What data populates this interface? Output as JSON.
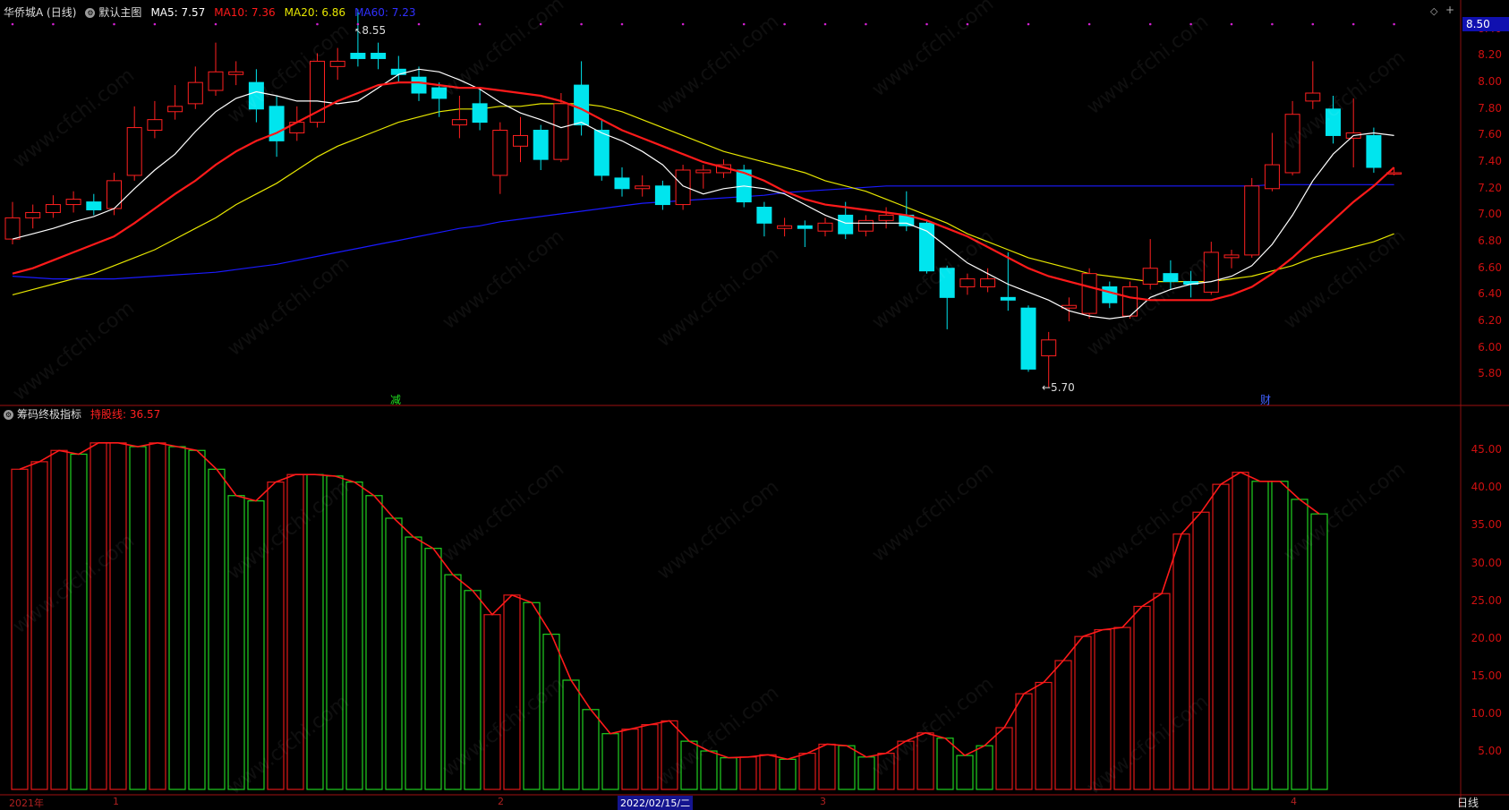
{
  "header": {
    "stock_name": "华侨城A",
    "period": "(日线)",
    "chart_label": "默认主图",
    "ma5": "MA5: 7.57",
    "ma10": "MA10: 7.36",
    "ma20": "MA20: 6.86",
    "ma60": "MA60: 7.23"
  },
  "indicator_header": {
    "name": "筹码终极指标",
    "line": "持股线: 36.57"
  },
  "price_axis": [
    "8.40",
    "8.20",
    "8.00",
    "7.80",
    "7.60",
    "7.40",
    "7.20",
    "7.00",
    "6.80",
    "6.60",
    "6.40",
    "6.20",
    "6.00",
    "5.80"
  ],
  "current_price_tag": "8.50",
  "indicator_axis": [
    "45.00",
    "40.00",
    "35.00",
    "30.00",
    "25.00",
    "20.00",
    "15.00",
    "10.00",
    "5.00"
  ],
  "annotations": {
    "high": "8.55",
    "low": "←5.70",
    "mark_jian": "减",
    "mark_cai": "财"
  },
  "bottom_axis": {
    "year": "2021年",
    "m1": "1",
    "m2": "2",
    "cursor_date": "2022/02/15/二",
    "m3": "3",
    "m4": "4",
    "day_button": "日线"
  },
  "watermark": "www.cfchi.com",
  "colors": {
    "up": "#ff2020",
    "down": "#00e5ee",
    "ma5": "#ffffff",
    "ma10": "#ff1a1a",
    "ma20": "#e6e600",
    "ma60": "#1a1aff",
    "bar_up": "#e01818",
    "bar_down": "#20d020"
  },
  "chart_data": [
    {
      "type": "candlestick",
      "title": "华侨城A (日线)",
      "ylim": [
        5.6,
        8.5
      ],
      "candles": [
        [
          6.82,
          6.98,
          7.1,
          6.78
        ],
        [
          6.98,
          7.02,
          7.08,
          6.9
        ],
        [
          7.02,
          7.08,
          7.15,
          6.98
        ],
        [
          7.08,
          7.12,
          7.18,
          7.02
        ],
        [
          7.1,
          7.04,
          7.16,
          7.0
        ],
        [
          7.05,
          7.26,
          7.32,
          7.0
        ],
        [
          7.3,
          7.66,
          7.82,
          7.26
        ],
        [
          7.64,
          7.72,
          7.86,
          7.58
        ],
        [
          7.78,
          7.82,
          7.98,
          7.72
        ],
        [
          7.84,
          8.0,
          8.12,
          7.8
        ],
        [
          7.94,
          8.08,
          8.3,
          7.9
        ],
        [
          8.06,
          8.08,
          8.16,
          7.98
        ],
        [
          8.0,
          7.8,
          8.1,
          7.7
        ],
        [
          7.82,
          7.56,
          7.9,
          7.44
        ],
        [
          7.62,
          7.7,
          7.82,
          7.56
        ],
        [
          7.7,
          8.16,
          8.22,
          7.66
        ],
        [
          8.12,
          8.16,
          8.26,
          8.02
        ],
        [
          8.22,
          8.18,
          8.55,
          8.12
        ],
        [
          8.22,
          8.18,
          8.3,
          8.1
        ],
        [
          8.1,
          8.06,
          8.2,
          8.0
        ],
        [
          8.04,
          7.92,
          8.12,
          7.86
        ],
        [
          7.96,
          7.88,
          8.0,
          7.74
        ],
        [
          7.68,
          7.72,
          7.9,
          7.58
        ],
        [
          7.84,
          7.7,
          7.96,
          7.64
        ],
        [
          7.3,
          7.64,
          7.7,
          7.16
        ],
        [
          7.52,
          7.6,
          7.74,
          7.4
        ],
        [
          7.64,
          7.42,
          7.68,
          7.34
        ],
        [
          7.42,
          7.84,
          7.92,
          7.4
        ],
        [
          7.98,
          7.68,
          8.16,
          7.6
        ],
        [
          7.64,
          7.3,
          7.72,
          7.26
        ],
        [
          7.28,
          7.2,
          7.36,
          7.14
        ],
        [
          7.2,
          7.22,
          7.3,
          7.14
        ],
        [
          7.22,
          7.08,
          7.26,
          7.04
        ],
        [
          7.08,
          7.34,
          7.38,
          7.04
        ],
        [
          7.32,
          7.34,
          7.38,
          7.2
        ],
        [
          7.32,
          7.38,
          7.42,
          7.28
        ],
        [
          7.34,
          7.1,
          7.38,
          7.06
        ],
        [
          7.06,
          6.94,
          7.1,
          6.84
        ],
        [
          6.9,
          6.92,
          6.98,
          6.84
        ],
        [
          6.92,
          6.9,
          6.96,
          6.76
        ],
        [
          6.88,
          6.94,
          6.98,
          6.84
        ],
        [
          7.0,
          6.86,
          7.1,
          6.82
        ],
        [
          6.88,
          6.96,
          7.0,
          6.84
        ],
        [
          6.96,
          7.0,
          7.06,
          6.9
        ],
        [
          7.0,
          6.92,
          7.18,
          6.88
        ],
        [
          6.94,
          6.58,
          6.96,
          6.56
        ],
        [
          6.6,
          6.38,
          6.62,
          6.14
        ],
        [
          6.46,
          6.52,
          6.56,
          6.4
        ],
        [
          6.46,
          6.52,
          6.6,
          6.42
        ],
        [
          6.38,
          6.36,
          6.72,
          6.28
        ],
        [
          6.3,
          5.84,
          6.32,
          5.82
        ],
        [
          5.94,
          6.06,
          6.12,
          5.7
        ],
        [
          6.3,
          6.32,
          6.38,
          6.2
        ],
        [
          6.26,
          6.56,
          6.6,
          6.22
        ],
        [
          6.46,
          6.34,
          6.5,
          6.3
        ],
        [
          6.24,
          6.46,
          6.5,
          6.22
        ],
        [
          6.48,
          6.6,
          6.82,
          6.44
        ],
        [
          6.56,
          6.5,
          6.66,
          6.44
        ],
        [
          6.5,
          6.48,
          6.58,
          6.38
        ],
        [
          6.42,
          6.72,
          6.8,
          6.4
        ],
        [
          6.68,
          6.7,
          6.74,
          6.6
        ],
        [
          6.7,
          7.22,
          7.28,
          6.68
        ],
        [
          7.2,
          7.38,
          7.62,
          7.18
        ],
        [
          7.32,
          7.76,
          7.86,
          7.3
        ],
        [
          7.86,
          7.92,
          8.16,
          7.8
        ],
        [
          7.8,
          7.6,
          7.9,
          7.54
        ],
        [
          7.58,
          7.62,
          7.88,
          7.36
        ],
        [
          7.6,
          7.36,
          7.66,
          7.32
        ],
        [
          7.32,
          7.32,
          7.36,
          7.3
        ]
      ],
      "ma5": [
        6.82,
        6.86,
        6.9,
        6.95,
        6.99,
        7.05,
        7.2,
        7.34,
        7.46,
        7.63,
        7.78,
        7.88,
        7.93,
        7.9,
        7.86,
        7.86,
        7.84,
        7.86,
        7.96,
        8.06,
        8.1,
        8.08,
        8.02,
        7.95,
        7.85,
        7.77,
        7.72,
        7.66,
        7.7,
        7.62,
        7.56,
        7.48,
        7.38,
        7.22,
        7.16,
        7.2,
        7.22,
        7.2,
        7.16,
        7.08,
        7.0,
        6.94,
        6.94,
        6.94,
        6.94,
        6.88,
        6.76,
        6.64,
        6.56,
        6.48,
        6.42,
        6.36,
        6.28,
        6.24,
        6.22,
        6.24,
        6.38,
        6.44,
        6.48,
        6.5,
        6.54,
        6.62,
        6.78,
        7.0,
        7.26,
        7.46,
        7.6,
        7.62,
        7.6
      ],
      "ma10": [
        6.56,
        6.6,
        6.66,
        6.72,
        6.78,
        6.84,
        6.94,
        7.05,
        7.16,
        7.26,
        7.38,
        7.48,
        7.56,
        7.62,
        7.7,
        7.78,
        7.86,
        7.92,
        7.98,
        8.0,
        8.0,
        7.98,
        7.96,
        7.96,
        7.94,
        7.92,
        7.9,
        7.86,
        7.8,
        7.72,
        7.64,
        7.58,
        7.52,
        7.46,
        7.4,
        7.36,
        7.32,
        7.26,
        7.18,
        7.12,
        7.08,
        7.06,
        7.04,
        7.02,
        7.0,
        6.96,
        6.9,
        6.84,
        6.76,
        6.68,
        6.6,
        6.54,
        6.5,
        6.46,
        6.42,
        6.38,
        6.36,
        6.36,
        6.36,
        6.36,
        6.4,
        6.46,
        6.56,
        6.68,
        6.82,
        6.96,
        7.1,
        7.22,
        7.36
      ],
      "ma20": [
        6.4,
        6.44,
        6.48,
        6.52,
        6.56,
        6.62,
        6.68,
        6.74,
        6.82,
        6.9,
        6.98,
        7.08,
        7.16,
        7.24,
        7.34,
        7.44,
        7.52,
        7.58,
        7.64,
        7.7,
        7.74,
        7.78,
        7.8,
        7.8,
        7.82,
        7.82,
        7.84,
        7.84,
        7.84,
        7.82,
        7.78,
        7.72,
        7.66,
        7.6,
        7.54,
        7.48,
        7.44,
        7.4,
        7.36,
        7.32,
        7.26,
        7.22,
        7.18,
        7.12,
        7.06,
        7.0,
        6.94,
        6.86,
        6.8,
        6.74,
        6.68,
        6.64,
        6.6,
        6.56,
        6.54,
        6.52,
        6.5,
        6.5,
        6.5,
        6.5,
        6.52,
        6.54,
        6.58,
        6.62,
        6.68,
        6.72,
        6.76,
        6.8,
        6.86
      ],
      "ma60": [
        6.54,
        6.53,
        6.52,
        6.52,
        6.52,
        6.52,
        6.53,
        6.54,
        6.55,
        6.56,
        6.57,
        6.59,
        6.61,
        6.63,
        6.66,
        6.69,
        6.72,
        6.75,
        6.78,
        6.81,
        6.84,
        6.87,
        6.9,
        6.92,
        6.95,
        6.97,
        6.99,
        7.01,
        7.03,
        7.05,
        7.07,
        7.09,
        7.1,
        7.11,
        7.12,
        7.13,
        7.14,
        7.15,
        7.17,
        7.18,
        7.19,
        7.2,
        7.21,
        7.22,
        7.22,
        7.22,
        7.22,
        7.22,
        7.22,
        7.22,
        7.22,
        7.22,
        7.22,
        7.22,
        7.22,
        7.22,
        7.22,
        7.22,
        7.22,
        7.22,
        7.22,
        7.22,
        7.23,
        7.23,
        7.23,
        7.23,
        7.23,
        7.23,
        7.23
      ]
    },
    {
      "type": "bar",
      "title": "筹码终极指标",
      "ylim": [
        0,
        48
      ],
      "series": [
        {
          "name": "持股线",
          "values": [
            42.5,
            43.5,
            45.0,
            44.5,
            46.0,
            46.0,
            45.5,
            46.0,
            45.5,
            45.0,
            42.5,
            39.0,
            38.3,
            40.8,
            41.8,
            41.8,
            41.6,
            40.8,
            39.0,
            36.0,
            33.5,
            32.0,
            28.5,
            26.4,
            23.2,
            25.8,
            24.8,
            20.6,
            14.5,
            10.6,
            7.4,
            8.0,
            8.6,
            9.1,
            6.4,
            5.1,
            4.2,
            4.3,
            4.6,
            4.0,
            4.8,
            6.0,
            5.8,
            4.3,
            4.8,
            6.4,
            7.5,
            6.8,
            4.5,
            5.8,
            8.2,
            12.7,
            14.2,
            17.1,
            20.3,
            21.2,
            21.5,
            24.3,
            26.0,
            33.9,
            36.8,
            40.5,
            42.1,
            40.9,
            40.9,
            38.5,
            36.57
          ]
        }
      ],
      "bar_colors": [
        "up",
        "up",
        "up",
        "down",
        "up",
        "up",
        "down",
        "up",
        "down",
        "down",
        "down",
        "down",
        "down",
        "up",
        "up",
        "down",
        "down",
        "down",
        "down",
        "down",
        "down",
        "down",
        "down",
        "down",
        "up",
        "up",
        "down",
        "down",
        "down",
        "down",
        "down",
        "up",
        "up",
        "up",
        "down",
        "down",
        "down",
        "up",
        "up",
        "down",
        "up",
        "up",
        "down",
        "down",
        "up",
        "up",
        "up",
        "down",
        "down",
        "down",
        "up",
        "up",
        "up",
        "up",
        "up",
        "up",
        "up",
        "up",
        "up",
        "up",
        "up",
        "up",
        "up",
        "down",
        "down",
        "down",
        "down"
      ]
    }
  ]
}
